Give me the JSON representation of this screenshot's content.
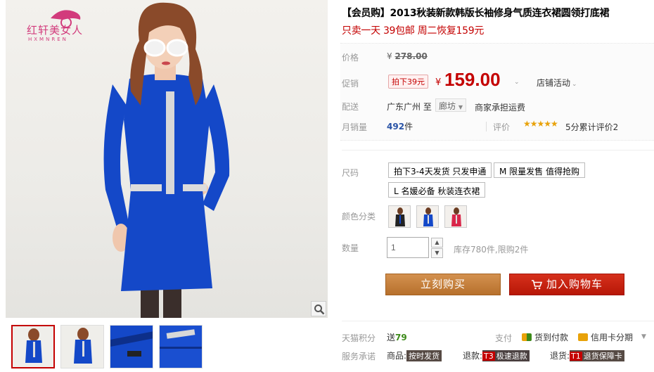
{
  "brand": {
    "logo_name": "红轩美女人",
    "logo_sub": "HXMNREN"
  },
  "product": {
    "title": "【会员购】2013秋装新款韩版长袖修身气质连衣裙圆领打底裙",
    "subtitle": "只卖一天 39包邮 周二恢复159元"
  },
  "price": {
    "orig_label": "价格",
    "currency": "¥",
    "orig_value": "278.00",
    "promo_label": "促销",
    "promo_tag": "拍下39元",
    "current_value": "159.00",
    "shop_activity": "店铺活动"
  },
  "shipping": {
    "label": "配送",
    "from": "广东广州 至",
    "to": "廊坊",
    "fee": "商家承担运费"
  },
  "sales": {
    "label": "月销量",
    "count": "492",
    "unit": "件",
    "rating_label": "评价",
    "stars": "★★★★★",
    "rating_text": "5分累计评价2"
  },
  "sku": {
    "size_label": "尺码",
    "sizes": [
      "拍下3-4天发货 只发申通",
      "M 限量发售 值得抢购",
      "L 名媛必备 秋装连衣裙"
    ],
    "color_label": "颜色分类"
  },
  "quantity": {
    "label": "数量",
    "value": "1",
    "stock": "库存780件,限购2件"
  },
  "actions": {
    "buy_now": "立刻购买",
    "add_cart": "加入购物车"
  },
  "services": {
    "points_label": "天猫积分",
    "points_prefix": "送",
    "points_value": "79",
    "pay_label": "支付",
    "pay_cod": "货到付款",
    "pay_credit": "信用卡分期",
    "promise_label": "服务承诺",
    "promises": [
      {
        "prefix": "商品:",
        "key": "",
        "badge": "按时发货"
      },
      {
        "prefix": "退款:",
        "key": "T3",
        "badge": "极速退款"
      },
      {
        "prefix": "退货:",
        "key": "T1",
        "badge": "退货保障卡"
      }
    ]
  },
  "colors": {
    "price_red": "#c40000",
    "dress_blue": "#1448c8",
    "buy_orange": "#c17a35",
    "cart_red": "#c8230f",
    "tmall_green": "#3c8a19"
  }
}
